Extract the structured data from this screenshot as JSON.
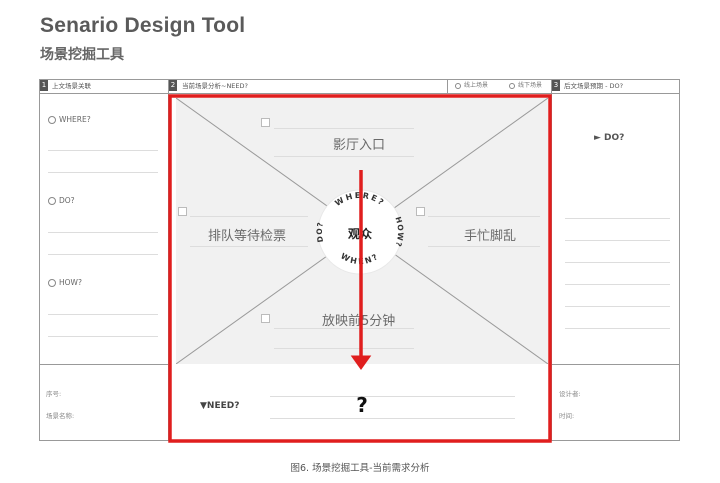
{
  "header": {
    "title": "Senario Design Tool",
    "subtitle": "场景挖掘工具"
  },
  "sections": {
    "left": {
      "number": "1",
      "title": "上文场景关联"
    },
    "center": {
      "number": "2",
      "title": "当前场景分析~NEED?",
      "options": [
        "线上场景",
        "线下场景"
      ]
    },
    "right": {
      "number": "3",
      "title": "后文场景预期 - DO?"
    }
  },
  "left_labels": [
    "WHERE?",
    "DO?",
    "HOW?"
  ],
  "right_label": "► DO?",
  "scenes": {
    "top": "影厅入口",
    "left": "排队等待检票",
    "right": "手忙脚乱",
    "bottom": "放映前5分钟"
  },
  "hub": {
    "center": "观众",
    "ring_where": "WHERE?",
    "ring_how": "HOW?",
    "ring_when": "WHEN?",
    "ring_do": "DO?"
  },
  "need": {
    "label": "▼NEED?",
    "answer": "?"
  },
  "footer": {
    "left": [
      "序号:",
      "场景名称:"
    ],
    "right": [
      "设计者:",
      "时间:"
    ]
  },
  "colors": {
    "highlight": "#e01e1e",
    "panel": "#f1f1f1",
    "border": "#999999"
  },
  "caption": "图6. 场景挖掘工具-当前需求分析"
}
